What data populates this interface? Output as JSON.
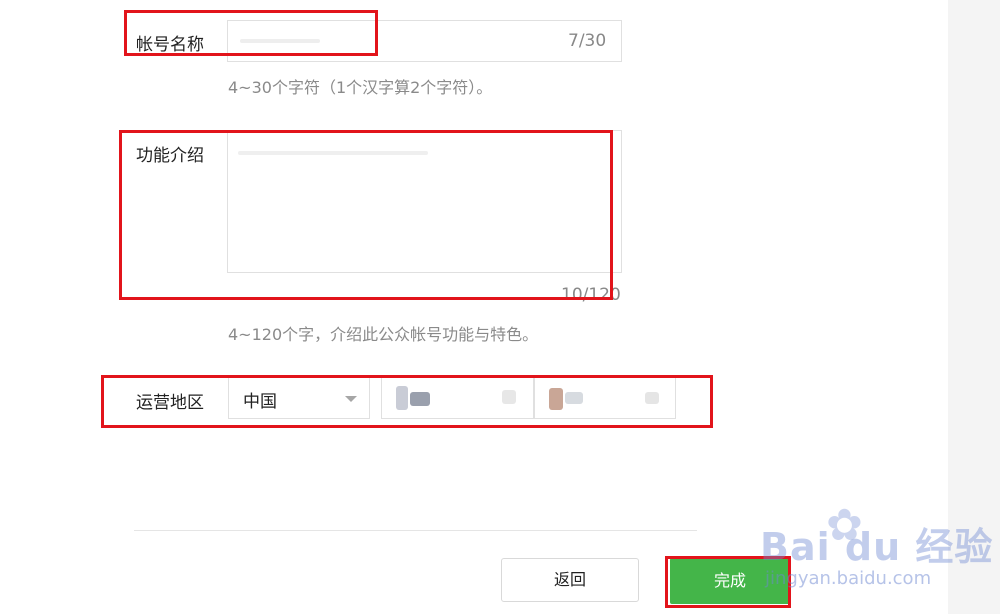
{
  "form": {
    "account_name": {
      "label": "帐号名称",
      "counter": "7/30",
      "hint": "4~30个字符（1个汉字算2个字符）。"
    },
    "description": {
      "label": "功能介绍",
      "counter": "10/120",
      "hint": "4~120个字，介绍此公众帐号功能与特色。"
    },
    "region": {
      "label": "运营地区",
      "country": "中国"
    }
  },
  "buttons": {
    "back": "返回",
    "done": "完成"
  },
  "watermark": {
    "logo": "Bai du 经验",
    "url": "jingyan.baidu.com"
  },
  "colors": {
    "primary_green": "#44b549",
    "highlight_red": "#e2141b"
  }
}
